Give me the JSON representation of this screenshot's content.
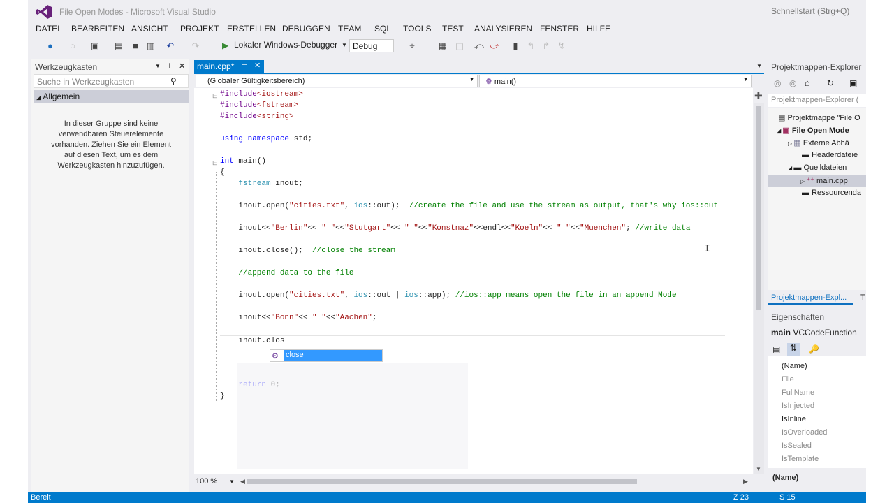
{
  "app": {
    "title": "File Open Modes - Microsoft Visual Studio",
    "quicklaunch_placeholder": "Schnellstart (Strg+Q)"
  },
  "menu": [
    "DATEI",
    "BEARBEITEN",
    "ANSICHT",
    "PROJEKT",
    "ERSTELLEN",
    "DEBUGGEN",
    "TEAM",
    "SQL",
    "TOOLS",
    "TEST",
    "ANALYSIEREN",
    "FENSTER",
    "HILFE"
  ],
  "toolbar": {
    "debug_target": "Lokaler Windows-Debugger",
    "configuration": "Debug"
  },
  "toolbox": {
    "title": "Werkzeugkasten",
    "search_placeholder": "Suche in Werkzeugkasten",
    "group": "Allgemein",
    "message": "In dieser Gruppe sind keine verwendbaren Steuerelemente vorhanden. Ziehen Sie ein Element auf diesen Text, um es dem Werkzeugkasten hinzuzufügen."
  },
  "editor": {
    "tab_label": "main.cpp*",
    "scope": "(Globaler Gültigkeitsbereich)",
    "member": "main()",
    "zoom": "100 %",
    "intellisense_item": "close"
  },
  "solution_explorer": {
    "title": "Projektmappen-Explorer",
    "search_placeholder": "Projektmappen-Explorer (",
    "items": [
      "Projektmappe \"File O",
      "File Open Mode",
      "Externe Abhä",
      "Headerdateie",
      "Quelldateien",
      "main.cpp",
      "Ressourcenda"
    ],
    "tab_label": "Projektmappen-Expl..."
  },
  "properties": {
    "title": "Eigenschaften",
    "object_name": "main",
    "object_type": "VCCodeFunction",
    "rows": [
      "(Name)",
      "File",
      "FullName",
      "IsInjected",
      "IsInline",
      "IsOverloaded",
      "IsSealed",
      "IsTemplate"
    ],
    "description_title": "(Name)"
  },
  "status": {
    "text": "Bereit",
    "line": "Z 23",
    "col": "S 15"
  }
}
